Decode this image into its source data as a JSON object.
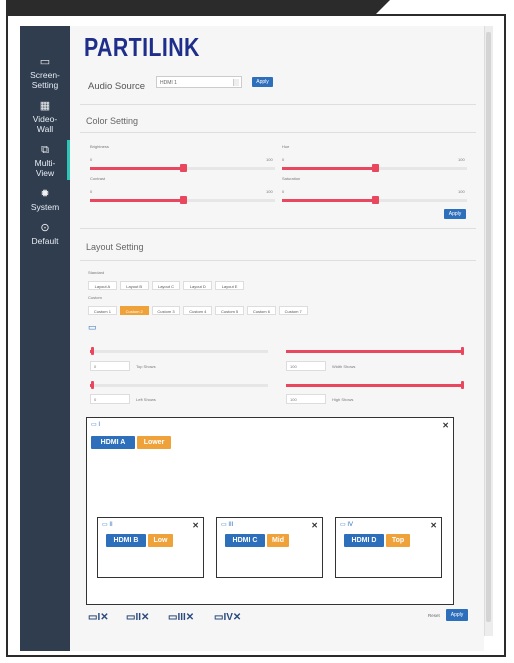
{
  "sidebar": {
    "items": [
      {
        "icon": "monitor-icon",
        "glyph": "▭",
        "label": "Screen-\nSetting"
      },
      {
        "icon": "grid-icon",
        "glyph": "▦",
        "label": "Video-\nWall"
      },
      {
        "icon": "multiview-icon",
        "glyph": "⧉",
        "label": "Multi-\nView"
      },
      {
        "icon": "gear-icon",
        "glyph": "✹",
        "label": "System"
      },
      {
        "icon": "reset-icon",
        "glyph": "⊙",
        "label": "Default"
      }
    ],
    "active_index": 2
  },
  "header": {
    "logo": "PARTILINK"
  },
  "audio": {
    "label": "Audio Source",
    "selected": "HDMI 1",
    "apply_label": "Apply"
  },
  "color": {
    "title": "Color Setting",
    "sliders": [
      {
        "name": "Brightness",
        "min": "0",
        "max": "100",
        "value": 50
      },
      {
        "name": "Hue",
        "min": "0",
        "max": "100",
        "value": 50
      },
      {
        "name": "Contrast",
        "min": "0",
        "max": "100",
        "value": 50
      },
      {
        "name": "Saturation",
        "min": "0",
        "max": "100",
        "value": 50
      }
    ],
    "apply_label": "Apply"
  },
  "layout": {
    "title": "Layout Setting",
    "standard_label": "Standard",
    "standard": [
      "Layout A",
      "Layout B",
      "Layout C",
      "Layout D",
      "Layout E"
    ],
    "custom_label": "Custom",
    "custom": [
      "Custom 1",
      "Custom 2",
      "Custom 3",
      "Custom 4",
      "Custom 5",
      "Custom 6",
      "Custom 7"
    ],
    "custom_selected": 1,
    "fields": {
      "top_shows": {
        "label": "Top Shows",
        "value": "0",
        "level": 0.02
      },
      "width_shows": {
        "label": "Width Shows",
        "value": "100",
        "level": 1.0
      },
      "left_shows": {
        "label": "Left Shows",
        "value": "0",
        "level": 0.02
      },
      "high_shows": {
        "label": "High Shows",
        "value": "100",
        "level": 1.0
      }
    }
  },
  "windows": [
    {
      "num": "I",
      "source": "HDMI A",
      "layer": "Lower"
    },
    {
      "num": "II",
      "source": "HDMI B",
      "layer": "Low"
    },
    {
      "num": "III",
      "source": "HDMI C",
      "layer": "Mid"
    },
    {
      "num": "IV",
      "source": "HDMI D",
      "layer": "Top"
    }
  ],
  "bottom": {
    "toggles": [
      "I",
      "II",
      "III",
      "IV"
    ],
    "reset_label": "Reset",
    "apply_label": "Apply"
  },
  "colors": {
    "accent_blue": "#2e6fbc",
    "accent_red": "#e8475e",
    "accent_orange": "#f0a23a",
    "sidebar_bg": "#2f3d4f",
    "logo_blue": "#1f2e8a"
  }
}
